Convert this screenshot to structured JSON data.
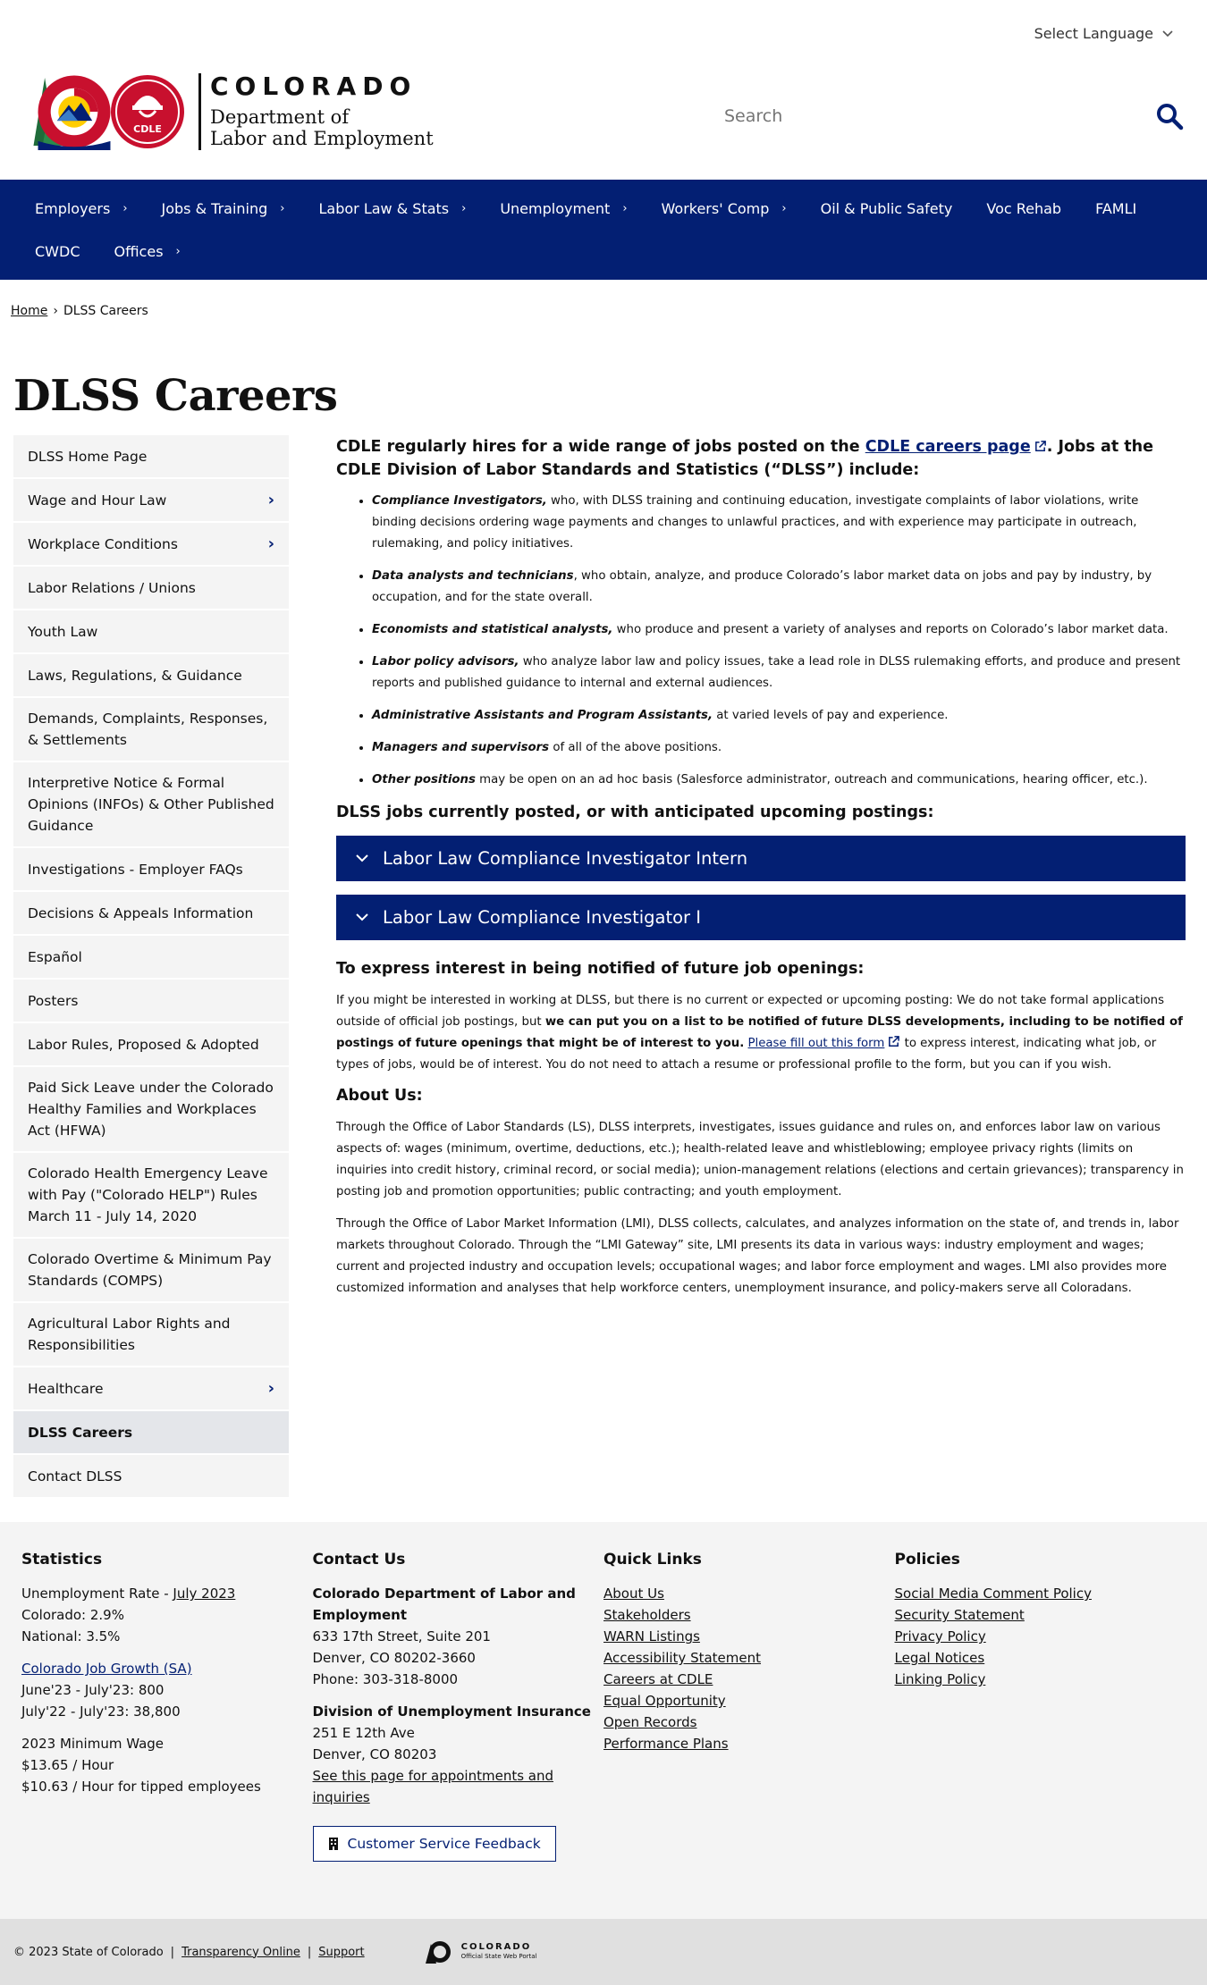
{
  "header": {
    "language_label": "Select Language",
    "logo_state": "COLORADO",
    "logo_dept_line1": "Department of",
    "logo_dept_line2": "Labor and Employment",
    "logo_badge": "CDLE",
    "search_placeholder": "Search",
    "brand_color": "#031f73"
  },
  "nav": {
    "items": [
      {
        "label": "Employers",
        "has_children": true
      },
      {
        "label": "Jobs & Training",
        "has_children": true
      },
      {
        "label": "Labor Law & Stats",
        "has_children": true
      },
      {
        "label": "Unemployment",
        "has_children": true
      },
      {
        "label": "Workers' Comp",
        "has_children": true
      },
      {
        "label": "Oil & Public Safety",
        "has_children": false
      },
      {
        "label": "Voc Rehab",
        "has_children": false
      },
      {
        "label": "FAMLI",
        "has_children": false
      },
      {
        "label": "CWDC",
        "has_children": false
      },
      {
        "label": "Offices",
        "has_children": true
      }
    ]
  },
  "breadcrumb": {
    "home": "Home",
    "separator": "›",
    "current": "DLSS Careers"
  },
  "page_title": "DLSS Careers",
  "sidebar": {
    "items": [
      {
        "label": "DLSS Home Page",
        "arrow": ""
      },
      {
        "label": "Wage and Hour Law",
        "arrow": "›"
      },
      {
        "label": "Workplace Conditions",
        "arrow": "›"
      },
      {
        "label": "Labor Relations / Unions",
        "arrow": ""
      },
      {
        "label": "Youth Law",
        "arrow": ""
      },
      {
        "label": "Laws, Regulations, & Guidance",
        "arrow": ""
      },
      {
        "label": "Demands, Complaints, Responses, & Settlements",
        "arrow": ""
      },
      {
        "label": "Interpretive Notice & Formal Opinions (INFOs) & Other Published Guidance",
        "arrow": ""
      },
      {
        "label": "Investigations - Employer FAQs",
        "arrow": ""
      },
      {
        "label": "Decisions & Appeals Information",
        "arrow": ""
      },
      {
        "label": "Español",
        "arrow": ""
      },
      {
        "label": "Posters",
        "arrow": ""
      },
      {
        "label": "Labor Rules, Proposed & Adopted",
        "arrow": ""
      },
      {
        "label": "Paid Sick Leave under the Colorado Healthy Families and Workplaces Act (HFWA)",
        "arrow": ""
      },
      {
        "label": "Colorado Health Emergency Leave with Pay (\"Colorado HELP\") Rules March 11 - July 14, 2020",
        "arrow": ""
      },
      {
        "label": "Colorado Overtime & Minimum Pay Standards (COMPS)",
        "arrow": ""
      },
      {
        "label": "Agricultural Labor Rights and Responsibilities",
        "arrow": ""
      },
      {
        "label": "Healthcare",
        "arrow": "›"
      },
      {
        "label": "DLSS Careers",
        "arrow": "",
        "active": true
      },
      {
        "label": "Contact DLSS",
        "arrow": ""
      }
    ]
  },
  "content": {
    "lead_pre": "CDLE regularly hires for a wide range of jobs posted on the ",
    "lead_link": "CDLE careers page",
    "lead_post": ". Jobs at the CDLE Division of Labor Standards and Statistics (“DLSS”) include:",
    "jobs": [
      {
        "title": "Compliance Investigators,",
        "desc": " who, with DLSS training and continuing education, investigate complaints of labor violations, write binding decisions ordering wage payments and changes to unlawful practices, and with experience may participate in outreach, rulemaking, and policy initiatives."
      },
      {
        "title": "Data analysts and technicians",
        "desc": ", who obtain, analyze, and produce Colorado’s labor market data on jobs and pay by industry, by occupation, and for the state overall."
      },
      {
        "title": "Economists and statistical analysts,",
        "desc": " who produce and present a variety of analyses and reports on Colorado’s labor market data."
      },
      {
        "title": "Labor policy advisors,",
        "desc": " who analyze labor law and policy issues, take a lead role in DLSS rulemaking efforts, and produce and present reports and published guidance to internal and external audiences."
      },
      {
        "title": "Administrative Assistants and Program Assistants,",
        "desc": " at varied levels of pay and experience."
      },
      {
        "title": "Managers and supervisors",
        "desc": " of all of the above positions."
      },
      {
        "title": "Other positions",
        "desc": " may be open on an ad hoc basis (Salesforce administrator, outreach and communications, hearing officer, etc.)."
      }
    ],
    "postings_heading": "DLSS jobs currently posted, or with anticipated upcoming postings:",
    "accordions": [
      {
        "label": "Labor Law Compliance Investigator Intern"
      },
      {
        "label": "Labor Law Compliance Investigator I"
      }
    ],
    "interest_heading": "To express interest in being notified of future job openings:",
    "interest_p1": "If you might be interested in working at DLSS, but there is no current or expected or upcoming posting: We do not take formal applications outside of official job postings, but ",
    "interest_bold": "we can put you on a list to be notified of future DLSS developments, including to be notified of postings of future openings that might be of interest to you.",
    "interest_link": "Please fill out this form",
    "interest_p2": " to express interest, indicating what job, or types of jobs, would be of interest. You do not need to attach a resume or professional profile to the form, but you can if you wish.",
    "about_heading": "About Us:",
    "about_p1": "Through the Office of Labor Standards (LS), DLSS interprets, investigates, issues guidance and rules on, and enforces labor law on various aspects of: wages (minimum, overtime, deductions, etc.); health-related leave and whistleblowing; employee privacy rights (limits on inquiries into credit history, criminal record, or social media); union-management relations (elections and certain grievances); transparency in posting job and promotion opportunities; public contracting; and youth employment.",
    "about_p2": "Through the Office of Labor Market Information (LMI), DLSS collects, calculates, and analyzes information on the state of, and trends in, labor markets throughout Colorado. Through the “LMI Gateway” site, LMI presents its data in various ways: industry employment and wages; current and projected industry and occupation levels; occupational wages; and labor force employment and wages. LMI also provides more customized information and analyses that help workforce centers, unemployment insurance, and policy-makers serve all Coloradans."
  },
  "footer": {
    "statistics": {
      "heading": "Statistics",
      "unemp_label": "Unemployment Rate - ",
      "unemp_link": "July 2023",
      "colorado": "Colorado: 2.9%",
      "national": "National: 3.5%",
      "growth_link": "Colorado Job Growth (SA)",
      "growth1": "June'23 - July'23: 800",
      "growth2": "July'22 - July'23: 38,800",
      "minwage_label": "2023 Minimum Wage",
      "minwage1": "$13.65 / Hour",
      "minwage2": "$10.63 / Hour for tipped employees"
    },
    "contact": {
      "heading": "Contact Us",
      "org": "Colorado Department of Labor and Employment",
      "addr1": "633 17th Street, Suite 201",
      "addr2": "Denver, CO  80202-3660",
      "phone": "Phone: 303-318-8000",
      "div": "Division of Unemployment Insurance",
      "div_addr1": "251 E 12th Ave",
      "div_addr2": "Denver, CO  80203",
      "div_link": "See this page for appointments and inquiries",
      "feedback": "Customer Service Feedback"
    },
    "quick_links": {
      "heading": "Quick Links",
      "items": [
        "About Us",
        "Stakeholders",
        "WARN Listings",
        "Accessibility Statement",
        "Careers at CDLE",
        "Equal Opportunity",
        "Open Records",
        "Performance Plans"
      ]
    },
    "policies": {
      "heading": "Policies",
      "items": [
        "Social Media Comment Policy",
        "Security Statement",
        "Privacy Policy",
        "Legal Notices",
        "Linking Policy"
      ]
    }
  },
  "bottom": {
    "copyright": "© 2023 State of Colorado",
    "sep": "|",
    "transparency": "Transparency Online",
    "support": "Support",
    "portal_line1": "COLORADO",
    "portal_line2": "Official State Web Portal"
  }
}
